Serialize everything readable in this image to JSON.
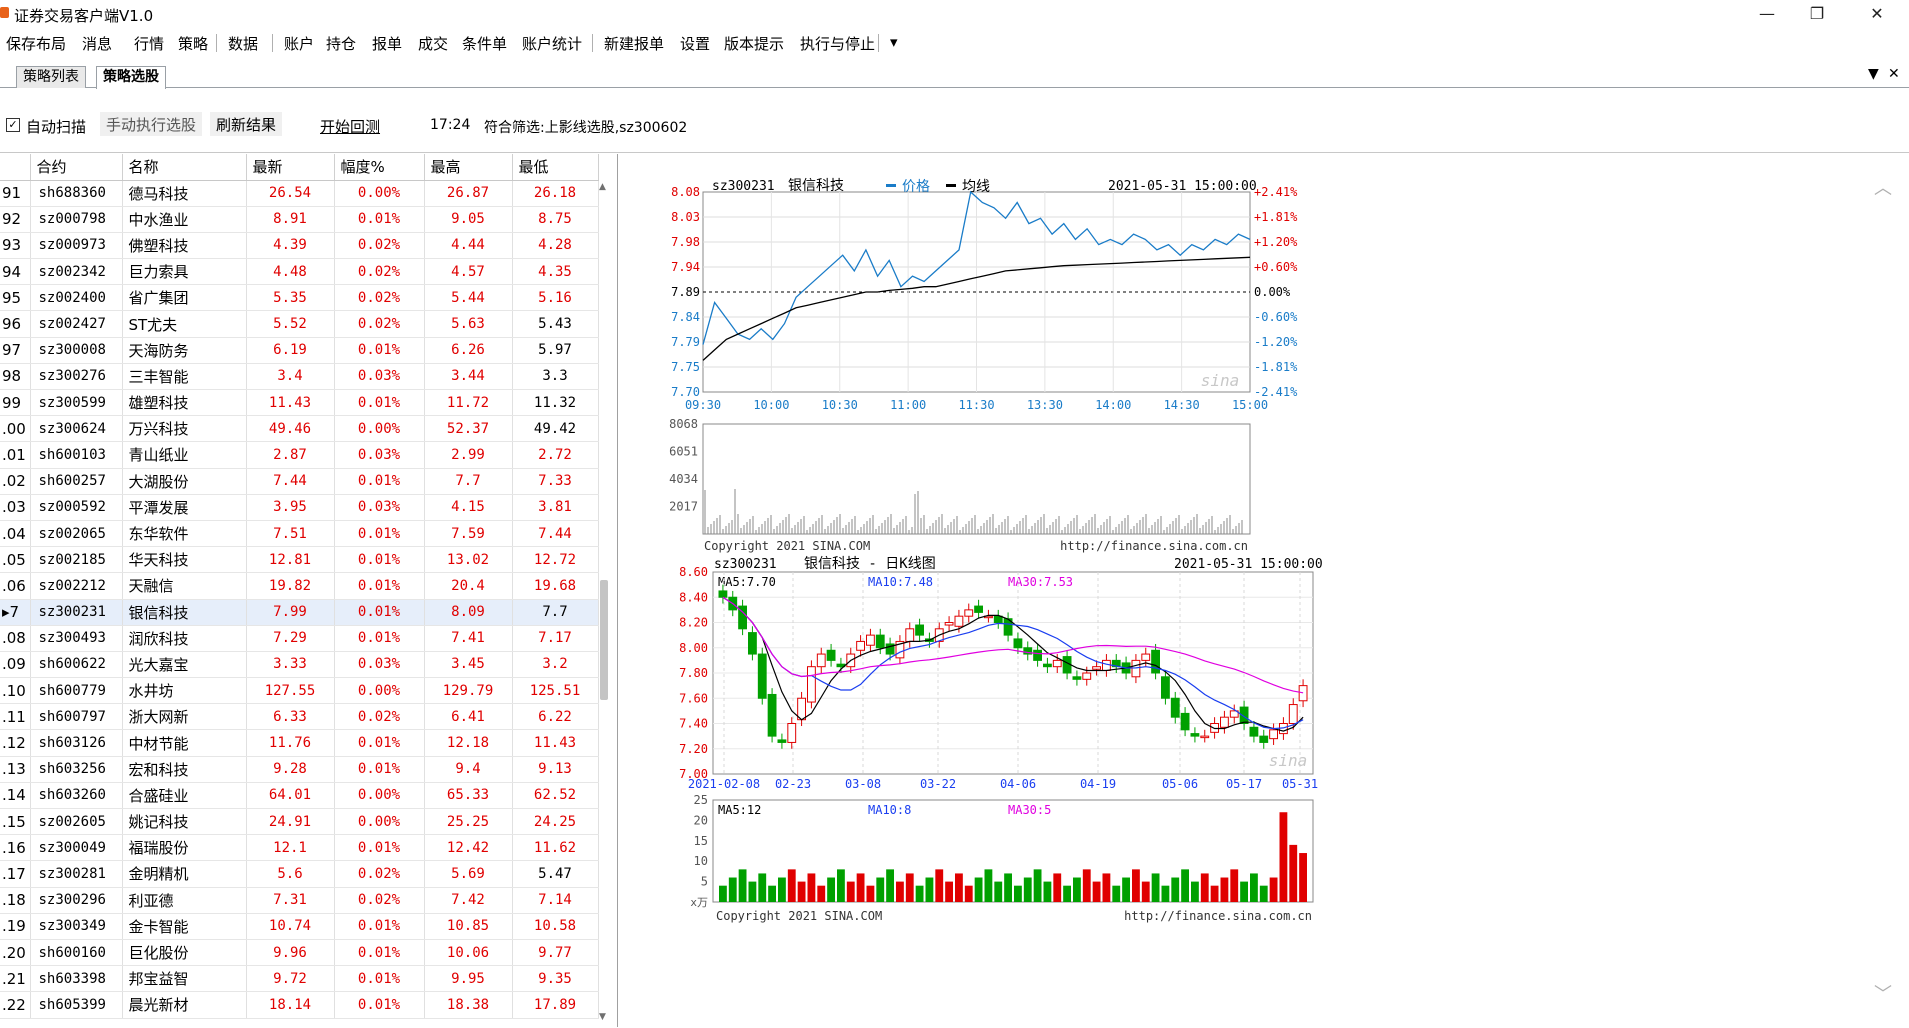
{
  "window": {
    "title": "证券交易客户端V1.0",
    "controls": [
      "—",
      "❐",
      "✕"
    ]
  },
  "menu": [
    "保存布局",
    "消息",
    "行情",
    "策略",
    "数据",
    "账户",
    "持仓",
    "报单",
    "成交",
    "条件单",
    "账户统计",
    "新建报单",
    "设置",
    "版本提示",
    "执行与停止",
    "▾"
  ],
  "tabs": [
    {
      "label": "策略列表",
      "active": false
    },
    {
      "label": "策略选股",
      "active": true
    }
  ],
  "tab_controls": {
    "dropdown": "▼",
    "close": "✕"
  },
  "toolbar": {
    "auto_scan_label": "自动扫描",
    "auto_scan_checked": "✓",
    "manual_select_label": "手动执行选股",
    "refresh_label": "刷新结果",
    "backtest_label": "开始回测",
    "time": "17:24",
    "filter_text": "符合筛选:上影线选股,sz300602"
  },
  "grid": {
    "columns": [
      "合约",
      "名称",
      "最新",
      "幅度%",
      "最高",
      "最低"
    ],
    "rows": [
      [
        "91",
        "sh688360",
        "德马科技",
        "26.54",
        "0.00%",
        "26.87",
        "26.18"
      ],
      [
        "92",
        "sz000798",
        "中水渔业",
        "8.91",
        "0.01%",
        "9.05",
        "8.75"
      ],
      [
        "93",
        "sz000973",
        "佛塑科技",
        "4.39",
        "0.02%",
        "4.44",
        "4.28"
      ],
      [
        "94",
        "sz002342",
        "巨力索具",
        "4.48",
        "0.02%",
        "4.57",
        "4.35"
      ],
      [
        "95",
        "sz002400",
        "省广集团",
        "5.35",
        "0.02%",
        "5.44",
        "5.16"
      ],
      [
        "96",
        "sz002427",
        "ST尤夫",
        "5.52",
        "0.02%",
        "5.63",
        "5.43"
      ],
      [
        "97",
        "sz300008",
        "天海防务",
        "6.19",
        "0.01%",
        "6.26",
        "5.97"
      ],
      [
        "98",
        "sz300276",
        "三丰智能",
        "3.4",
        "0.03%",
        "3.44",
        "3.3"
      ],
      [
        "99",
        "sz300599",
        "雄塑科技",
        "11.43",
        "0.01%",
        "11.72",
        "11.32"
      ],
      [
        ".00",
        "sz300624",
        "万兴科技",
        "49.46",
        "0.00%",
        "52.37",
        "49.42"
      ],
      [
        ".01",
        "sh600103",
        "青山纸业",
        "2.87",
        "0.03%",
        "2.99",
        "2.72"
      ],
      [
        ".02",
        "sh600257",
        "大湖股份",
        "7.44",
        "0.01%",
        "7.7",
        "7.33"
      ],
      [
        ".03",
        "sz000592",
        "平潭发展",
        "3.95",
        "0.03%",
        "4.15",
        "3.81"
      ],
      [
        ".04",
        "sz002065",
        "东华软件",
        "7.51",
        "0.01%",
        "7.59",
        "7.44"
      ],
      [
        ".05",
        "sz002185",
        "华天科技",
        "12.81",
        "0.01%",
        "13.02",
        "12.72"
      ],
      [
        ".06",
        "sz002212",
        "天融信",
        "19.82",
        "0.01%",
        "20.4",
        "19.68"
      ],
      [
        "▸7",
        "sz300231",
        "银信科技",
        "7.99",
        "0.01%",
        "8.09",
        "7.7"
      ],
      [
        ".08",
        "sz300493",
        "润欣科技",
        "7.29",
        "0.01%",
        "7.41",
        "7.17"
      ],
      [
        ".09",
        "sh600622",
        "光大嘉宝",
        "3.33",
        "0.03%",
        "3.45",
        "3.2"
      ],
      [
        ".10",
        "sh600779",
        "水井坊",
        "127.55",
        "0.00%",
        "129.79",
        "125.51"
      ],
      [
        ".11",
        "sh600797",
        "浙大网新",
        "6.33",
        "0.02%",
        "6.41",
        "6.22"
      ],
      [
        ".12",
        "sh603126",
        "中材节能",
        "11.76",
        "0.01%",
        "12.18",
        "11.43"
      ],
      [
        ".13",
        "sh603256",
        "宏和科技",
        "9.28",
        "0.01%",
        "9.4",
        "9.13"
      ],
      [
        ".14",
        "sh603260",
        "合盛硅业",
        "64.01",
        "0.00%",
        "65.33",
        "62.52"
      ],
      [
        ".15",
        "sz002605",
        "姚记科技",
        "24.91",
        "0.00%",
        "25.25",
        "24.25"
      ],
      [
        ".16",
        "sz300049",
        "福瑞股份",
        "12.1",
        "0.01%",
        "12.42",
        "11.62"
      ],
      [
        ".17",
        "sz300281",
        "金明精机",
        "5.6",
        "0.02%",
        "5.69",
        "5.47"
      ],
      [
        ".18",
        "sz300296",
        "利亚德",
        "7.31",
        "0.02%",
        "7.42",
        "7.14"
      ],
      [
        ".19",
        "sz300349",
        "金卡智能",
        "10.74",
        "0.01%",
        "10.85",
        "10.58"
      ],
      [
        ".20",
        "sh600160",
        "巨化股份",
        "9.96",
        "0.01%",
        "10.06",
        "9.77"
      ],
      [
        ".21",
        "sh603398",
        "邦宝益智",
        "9.72",
        "0.01%",
        "9.95",
        "9.35"
      ],
      [
        ".22",
        "sh605399",
        "晨光新材",
        "18.14",
        "0.01%",
        "18.38",
        "17.89"
      ]
    ],
    "low_black_rows": [
      5,
      6,
      7,
      8,
      9,
      16,
      26
    ]
  },
  "intraday": {
    "code": "sz300231",
    "name": "银信科技",
    "legend_price": "价格",
    "legend_avg": "均线",
    "datetime": "2021-05-31 15:00:00",
    "left_ticks": [
      "8.08",
      "8.03",
      "7.98",
      "7.94",
      "7.89",
      "7.84",
      "7.79",
      "7.75",
      "7.70"
    ],
    "right_ticks": [
      "+2.41%",
      "+1.81%",
      "+1.20%",
      "+0.60%",
      "0.00%",
      "-0.60%",
      "-1.20%",
      "-1.81%",
      "-2.41%"
    ],
    "time_ticks": [
      "09:30",
      "10:00",
      "10:30",
      "11:00",
      "11:30",
      "13:30",
      "14:00",
      "14:30",
      "15:00"
    ],
    "vol_ticks": [
      "8068",
      "6051",
      "4034",
      "2017"
    ],
    "copyright": "Copyright 2021 SINA.COM",
    "url": "http://finance.sina.com.cn",
    "watermark": "sina",
    "colors": {
      "price": "#1a7cc8",
      "avg": "#000000",
      "up": "#e00000",
      "blue": "#1a7cc8"
    }
  },
  "kline": {
    "code": "sz300231",
    "title": "银信科技 - 日K线图",
    "datetime": "2021-05-31 15:00:00",
    "ma5": "MA5:7.70",
    "ma10": "MA10:7.48",
    "ma30": "MA30:7.53",
    "y_ticks": [
      "8.60",
      "8.40",
      "8.20",
      "8.00",
      "7.80",
      "7.60",
      "7.40",
      "7.20",
      "7.00"
    ],
    "x_ticks": [
      "2021-02-08",
      "02-23",
      "03-08",
      "03-22",
      "04-06",
      "04-19",
      "05-06",
      "05-17",
      "05-31"
    ],
    "vol_ticks": [
      "25",
      "20",
      "15",
      "10",
      "5"
    ],
    "vol_unit": "x万",
    "vol_ma5": "MA5:12",
    "vol_ma10": "MA10:8",
    "vol_ma30": "MA30:5",
    "copyright": "Copyright 2021 SINA.COM",
    "url": "http://finance.sina.com.cn",
    "watermark": "sina",
    "colors": {
      "up": "#e00000",
      "down": "#00a000",
      "ma5": "#000000",
      "ma10": "#1a3ef0",
      "ma30": "#e000e0"
    }
  }
}
